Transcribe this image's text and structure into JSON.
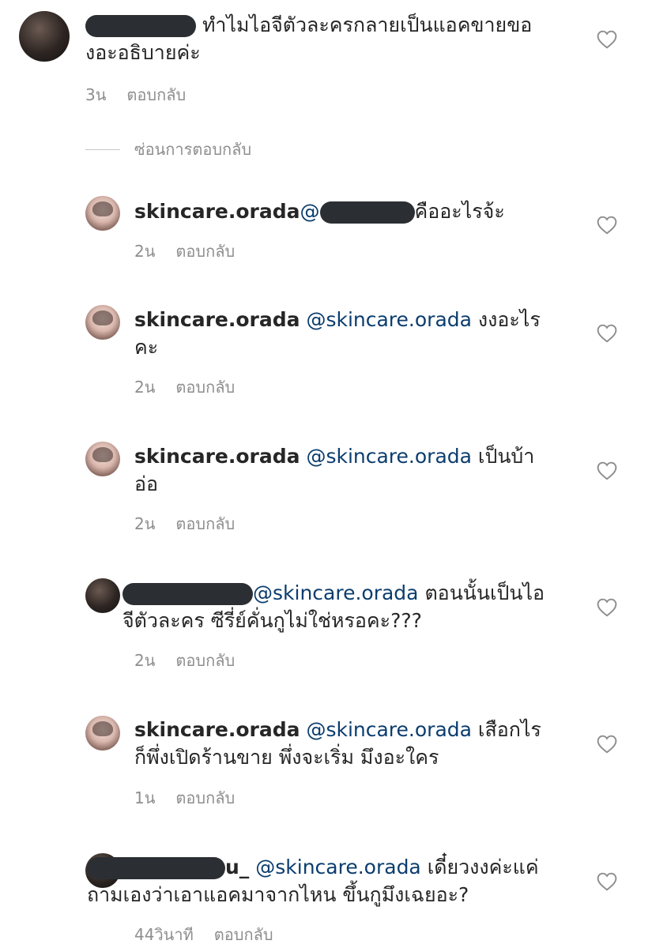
{
  "comments": [
    {
      "username": "",
      "mention": "",
      "text": " ทำไมไอจีตัวละครกลายเป็นแอคขายขอ\nงอะอธิบายค่ะ",
      "time": "3น",
      "reply_label": "ตอบกลับ"
    },
    {
      "username": "skincare.orada",
      "mention": "@",
      "text": "คืออะไรจ้ะ",
      "time": "2น",
      "reply_label": "ตอบกลับ"
    },
    {
      "username": "skincare.orada",
      "mention": "@skincare.orada",
      "text": " งงอะไร\nคะ",
      "time": "2น",
      "reply_label": "ตอบกลับ"
    },
    {
      "username": "skincare.orada",
      "mention": "@skincare.orada",
      "text": " เป็นบ้า\nอ่อ",
      "time": "2น",
      "reply_label": "ตอบกลับ"
    },
    {
      "username": "",
      "mention": "@skincare.orada",
      "text": " ตอนนั้นเป็นไอ\nจีตัวละคร ซีรี่ย์คั่นกูไม่ใช่หรอคะ???",
      "time": "2น",
      "reply_label": "ตอบกลับ"
    },
    {
      "username": "skincare.orada",
      "mention": "@skincare.orada",
      "text": " เสือกไร\nก็พึ่งเปิดร้านขาย พึ่งจะเริ่ม มึงอะใคร",
      "time": "1น",
      "reply_label": "ตอบกลับ"
    },
    {
      "username": "u_",
      "mention": " @skincare.orada",
      "text": " เดี๋ยวงงค่ะแค่\nถามเองว่าเอาแอคมาจากไหน ขึ้นกูมึงเฉยอะ?",
      "time": "44วินาที",
      "reply_label": "ตอบกลับ"
    }
  ],
  "thread": {
    "hide_replies_label": "ซ่อนการตอบกลับ"
  },
  "icons": {
    "like": "heart-outline-icon"
  },
  "colors": {
    "text": "#262626",
    "mention": "#0b3d6e",
    "meta": "#8e8e8e",
    "redaction": "#2b2f33"
  }
}
